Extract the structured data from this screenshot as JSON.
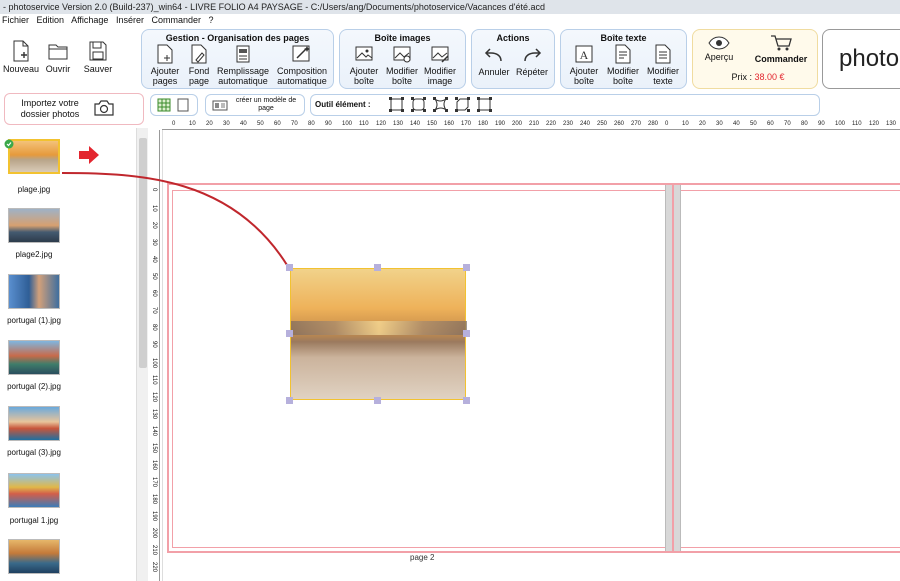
{
  "window": {
    "title": "- photoservice  Version 2.0 (Build-237)_win64 - LIVRE FOLIO A4 PAYSAGE - C:/Users/ang/Documents/photoservice/Vacances d'été.acd"
  },
  "menu": [
    "Fichier",
    "Edition",
    "Affichage",
    "Insérer",
    "Commander",
    "?"
  ],
  "toolbar": {
    "file": {
      "new": "Nouveau",
      "open": "Ouvrir",
      "save": "Sauver"
    },
    "gestion": {
      "title": "Gestion - Organisation des pages",
      "add_pages": "Ajouter pages",
      "background": "Fond page",
      "autofill": "Remplissage automatique",
      "autocompose": "Composition automatique"
    },
    "images": {
      "title": "Boîte images",
      "add_box": "Ajouter boîte",
      "edit_box": "Modifier boîte",
      "edit_image": "Modifier image"
    },
    "actions": {
      "title": "Actions",
      "undo": "Annuler",
      "redo": "Répéter"
    },
    "text": {
      "title": "Boîte texte",
      "add_box": "Ajouter boîte",
      "edit_box": "Modifier boîte",
      "edit_text": "Modifier texte"
    },
    "order": {
      "preview": "Aperçu",
      "order": "Commander",
      "price_label": "Prix :",
      "price": "38.00 €"
    },
    "brand": "photo"
  },
  "sidebar": {
    "import_label": "Importez votre dossier photos",
    "photos": [
      "plage.jpg",
      "plage2.jpg",
      "portugal (1).jpg",
      "portugal (2).jpg",
      "portugal (3).jpg",
      "portugal 1.jpg",
      ""
    ]
  },
  "edit_bar": {
    "create_template": "créer un modèle de page",
    "tool_label": "Outil élément :"
  },
  "ruler": {
    "h_ticks": [
      "0",
      "10",
      "20",
      "30",
      "40",
      "50",
      "60",
      "70",
      "80",
      "90",
      "100",
      "110",
      "120",
      "130",
      "140",
      "150",
      "160",
      "170",
      "180",
      "190",
      "200",
      "210",
      "220",
      "230",
      "240",
      "250",
      "260",
      "270",
      "280",
      "0",
      "10",
      "20",
      "30",
      "40",
      "50",
      "60",
      "70",
      "80",
      "90",
      "100",
      "110",
      "120",
      "130",
      "140"
    ],
    "v_ticks": [
      "0",
      "10",
      "20",
      "30",
      "40",
      "50",
      "60",
      "70",
      "80",
      "90",
      "100",
      "110",
      "120",
      "130",
      "140",
      "150",
      "160",
      "170",
      "180",
      "190",
      "200",
      "210",
      "220"
    ]
  },
  "canvas": {
    "page_label": "page 2"
  },
  "colors": {
    "accent_red": "#e3262f",
    "margin_pink": "#f2a0a8",
    "panel_blue": "#b9cfe8",
    "price_red": "#e3262f"
  }
}
